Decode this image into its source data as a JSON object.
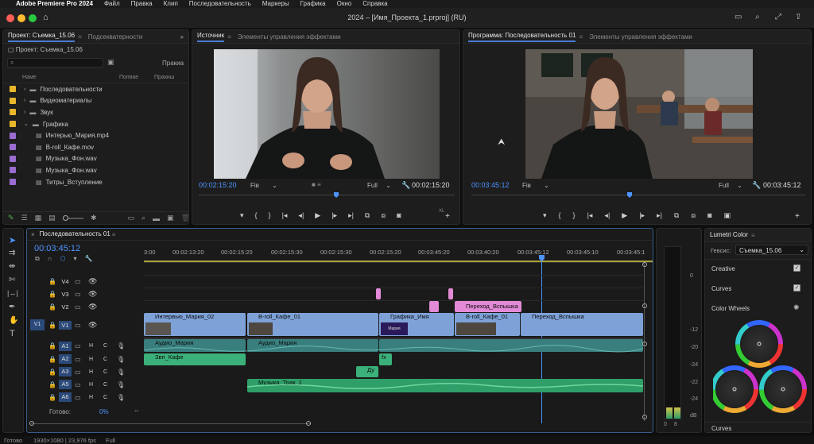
{
  "menubar": {
    "apple": "",
    "app": "Adobe Premiere Pro 2024",
    "items": [
      "Файл",
      "Правка",
      "Клип",
      "Последовательность",
      "Маркеры",
      "Графика",
      "Окно",
      "Справка"
    ]
  },
  "window": {
    "title": "2024 – [Имя_Проекта_1.prproj] (RU)"
  },
  "project_panel": {
    "tabs": [
      "Проект: Съемка_15.06",
      "Подсекватерности"
    ],
    "path": "Проект: Съемка_15.06",
    "search_placeholder": "",
    "right_label": "Пракиа",
    "columns": {
      "name": "Наме",
      "c2": "Попвае",
      "c3": "Пракиш"
    },
    "items": [
      {
        "name": "Последовательности",
        "color": "#e8b62a",
        "type": "folder"
      },
      {
        "name": "Видеоматериалы",
        "color": "#e8b62a",
        "type": "folder"
      },
      {
        "name": "Звук",
        "color": "#e8b62a",
        "type": "folder"
      },
      {
        "name": "Графика",
        "color": "#e8b62a",
        "type": "folder"
      },
      {
        "name": "Интерью_Мария.mp4",
        "color": "#9b6ccf",
        "type": "file"
      },
      {
        "name": "B-roll_Кафе.mov",
        "color": "#9b6ccf",
        "type": "file"
      },
      {
        "name": "Музыка_Фон.wav",
        "color": "#9b6ccf",
        "type": "file"
      },
      {
        "name": "Музыка_Фон.wav",
        "color": "#9b6ccf",
        "type": "file"
      },
      {
        "name": "Титры_Вступление",
        "color": "#9b6ccf",
        "type": "file"
      }
    ]
  },
  "source_monitor": {
    "tabs": [
      "Источник",
      "Элементы управления эффектами"
    ],
    "timecode_left": "00:02:15:20",
    "fit": "Fiв",
    "quality": "Full",
    "timecode_right": "00:02:15:20",
    "extra_label": "XL"
  },
  "program_monitor": {
    "tabs": [
      "Программа: Последовательность 01",
      "Элементы управления эффектами"
    ],
    "timecode_left": "00:03:45:12",
    "fit": "Fiв",
    "quality": "Full",
    "timecode_right": "00:03:45:12"
  },
  "timeline": {
    "tab": "Последовательность 01",
    "timecode": "00:03:45:12",
    "ruler": [
      "3:00",
      "00:02:13:20",
      "00:02:15:20",
      "00:02:15:30",
      "00:02:15:30",
      "00:02:15:20",
      "00:03:45:20",
      "00:03:40:20",
      "00:03:45:12",
      "00:03:45:10",
      "00:03:45:1"
    ],
    "video_tracks": [
      "V4",
      "V3",
      "V2",
      "V1"
    ],
    "audio_tracks": [
      "A1",
      "A2",
      "A3",
      "A5",
      "A6"
    ],
    "source_patch_v": "V1",
    "ms": [
      "Н",
      "С"
    ],
    "status_label": "Готово:",
    "status_value": "0%",
    "clips": {
      "v1_a": "Интервью_Мария_02",
      "v1_b": "B-roll_Кафе_01",
      "v1_c": "Графика_Имя",
      "v1_d": "B-roll_Кафе_01",
      "v1_e": "Переход_Вспышка",
      "v2_a": "Переход_Вспышка",
      "a1_a": "Аудио_Мария",
      "a1_b": "Аудио_Мария",
      "a2_a": "Звп_Кафе",
      "a3_a": "Ду",
      "a5_a": "Музыка_Трак_1",
      "fx": "fx",
      "grafika_inner": "Мария"
    }
  },
  "meters": {
    "ticks": [
      "0",
      "-12",
      "-20",
      "-24",
      "-22",
      "-24",
      "dB"
    ],
    "bottom": [
      "0",
      "8"
    ]
  },
  "lumetri": {
    "tab": "Lumetri Color",
    "preset_label": "Гевсис:",
    "preset_value": "Съемка_15.06",
    "sections": [
      "Creative",
      "Curves",
      "Color Wheels"
    ],
    "bottom": "Curves"
  },
  "statusbar": {
    "left": "Готово",
    "res": "1930×1080 | 23,976 fps",
    "quality": "Full"
  },
  "colors": {
    "accent": "#4e94ff",
    "video_clip": "#7ea2d8",
    "audio_clip": "#3bb07a",
    "pink_clip": "#e28ad6",
    "folder": "#e8b62a",
    "file": "#9b6ccf"
  }
}
